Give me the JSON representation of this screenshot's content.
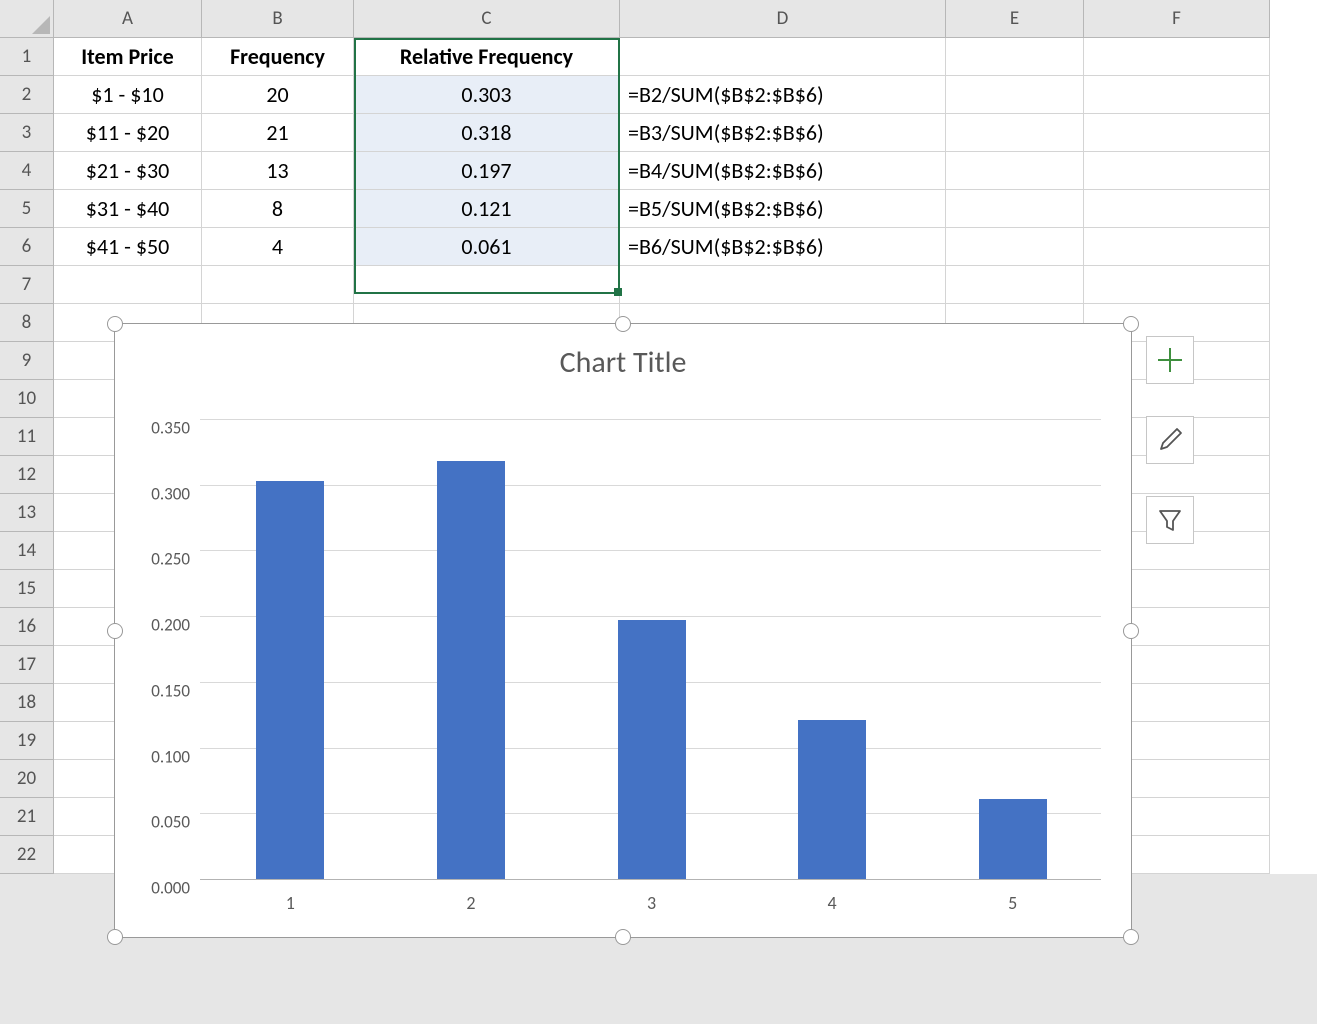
{
  "columns": [
    "A",
    "B",
    "C",
    "D",
    "E",
    "F"
  ],
  "row_count": 22,
  "headers": {
    "A": "Item Price",
    "B": "Frequency",
    "C": "Relative Frequency"
  },
  "rows": [
    {
      "A": "$1 - $10",
      "B": "20",
      "C": "0.303",
      "D": "=B2/SUM($B$2:$B$6)"
    },
    {
      "A": "$11 - $20",
      "B": "21",
      "C": "0.318",
      "D": "=B3/SUM($B$2:$B$6)"
    },
    {
      "A": "$21 - $30",
      "B": "13",
      "C": "0.197",
      "D": "=B4/SUM($B$2:$B$6)"
    },
    {
      "A": "$31 - $40",
      "B": "8",
      "C": "0.121",
      "D": "=B5/SUM($B$2:$B$6)"
    },
    {
      "A": "$41 - $50",
      "B": "4",
      "C": "0.061",
      "D": "=B6/SUM($B$2:$B$6)"
    }
  ],
  "selection": {
    "col": "C",
    "row_start": 2,
    "row_end": 6
  },
  "chart_data": {
    "type": "bar",
    "title": "Chart Title",
    "categories": [
      "1",
      "2",
      "3",
      "4",
      "5"
    ],
    "values": [
      0.303,
      0.318,
      0.197,
      0.121,
      0.061
    ],
    "ylim": [
      0,
      0.35
    ],
    "yticks": [
      "0.000",
      "0.050",
      "0.100",
      "0.150",
      "0.200",
      "0.250",
      "0.300",
      "0.350"
    ],
    "xlabel": "",
    "ylabel": ""
  },
  "chart_buttons": {
    "plus": "+",
    "brush": "brush-icon",
    "filter": "filter-icon"
  }
}
